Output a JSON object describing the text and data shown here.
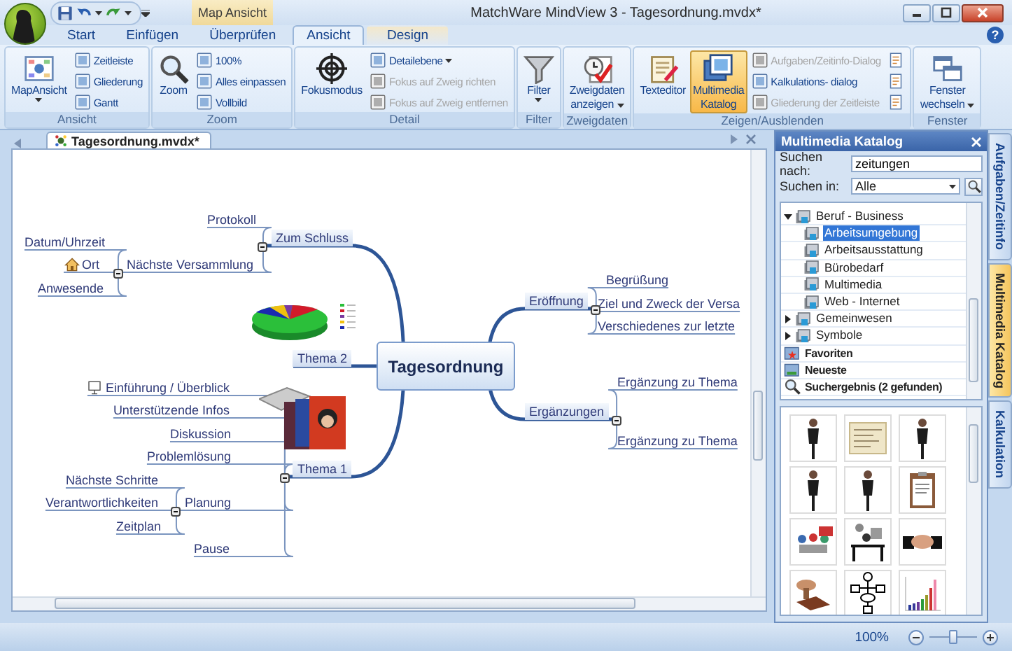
{
  "window": {
    "title": "MatchWare MindView 3 - Tagesordnung.mvdx*"
  },
  "contextual_tab": "Map Ansicht",
  "tabs": [
    {
      "label": "Start",
      "selected": false
    },
    {
      "label": "Einfügen",
      "selected": false
    },
    {
      "label": "Überprüfen",
      "selected": false
    },
    {
      "label": "Ansicht",
      "selected": true
    },
    {
      "label": "Design",
      "selected": false
    }
  ],
  "help_button": "?",
  "ribbon": [
    {
      "name": "Ansicht",
      "items": [
        {
          "label": [
            "MapAnsicht"
          ],
          "kind": "large",
          "dropdown": true,
          "disabled": false,
          "on": false
        },
        {
          "label": "Zeitleiste",
          "kind": "small",
          "dropdown": false,
          "disabled": false,
          "on": false
        },
        {
          "label": "Gliederung",
          "kind": "small",
          "dropdown": false,
          "disabled": false,
          "on": false
        },
        {
          "label": "Gantt",
          "kind": "small",
          "dropdown": false,
          "disabled": false,
          "on": false
        }
      ]
    },
    {
      "name": "Zoom",
      "items": [
        {
          "label": [
            "Zoom"
          ],
          "kind": "large",
          "dropdown": false,
          "disabled": false,
          "on": false
        },
        {
          "label": "100%",
          "kind": "small",
          "dropdown": false,
          "disabled": false,
          "on": false
        },
        {
          "label": "Alles einpassen",
          "kind": "small",
          "dropdown": false,
          "disabled": false,
          "on": false
        },
        {
          "label": "Vollbild",
          "kind": "small",
          "dropdown": false,
          "disabled": false,
          "on": false
        }
      ]
    },
    {
      "name": "Detail",
      "items": [
        {
          "label": [
            "Fokusmodus"
          ],
          "kind": "large",
          "dropdown": false,
          "disabled": false,
          "on": false
        },
        {
          "label": "Detailebene",
          "kind": "small",
          "dropdown": true,
          "disabled": false,
          "on": false
        },
        {
          "label": "Fokus auf Zweig richten",
          "kind": "small",
          "dropdown": false,
          "disabled": true,
          "on": false
        },
        {
          "label": "Fokus auf Zweig entfernen",
          "kind": "small",
          "dropdown": false,
          "disabled": true,
          "on": false
        }
      ]
    },
    {
      "name": "Filter",
      "items": [
        {
          "label": [
            "Filter"
          ],
          "kind": "large",
          "dropdown": true,
          "disabled": false,
          "on": false
        }
      ]
    },
    {
      "name": "Zweigdaten",
      "items": [
        {
          "label": [
            "Zweigdaten",
            "anzeigen"
          ],
          "kind": "large",
          "dropdown": true,
          "disabled": false,
          "on": false
        }
      ]
    },
    {
      "name": "Zeigen/Ausblenden",
      "items": [
        {
          "label": [
            "Texteditor"
          ],
          "kind": "large",
          "dropdown": false,
          "disabled": false,
          "on": false
        },
        {
          "label": [
            "Multimedia",
            "Katalog"
          ],
          "kind": "large",
          "dropdown": false,
          "disabled": false,
          "on": true
        },
        {
          "label": "Aufgaben/Zeitinfo-Dialog",
          "kind": "small",
          "dropdown": false,
          "disabled": true,
          "on": false
        },
        {
          "label": "Kalkulations- dialog",
          "kind": "small",
          "dropdown": false,
          "disabled": false,
          "on": false
        },
        {
          "label": "Gliederung der Zeitleiste",
          "kind": "small",
          "dropdown": false,
          "disabled": true,
          "on": false
        },
        {
          "kind": "icon",
          "dropdown": false,
          "disabled": false,
          "on": false
        },
        {
          "kind": "icon",
          "dropdown": false,
          "disabled": false,
          "on": false
        },
        {
          "kind": "icon",
          "dropdown": false,
          "disabled": false,
          "on": false
        }
      ]
    },
    {
      "name": "Fenster",
      "items": [
        {
          "label": [
            "Fenster",
            "wechseln"
          ],
          "kind": "large",
          "dropdown": true,
          "disabled": false,
          "on": false
        }
      ]
    }
  ],
  "document_tab": "Tagesordnung.mvdx*",
  "mind_map": {
    "central": "Tagesordnung",
    "branches": [
      {
        "label": "Zum Schluss",
        "kind": "topic",
        "expanded": true,
        "children": [
          {
            "label": "Protokoll",
            "kind": "topic"
          },
          {
            "label": "Nächste Versammlung",
            "kind": "topic",
            "expanded": true,
            "children": [
              {
                "label": "Datum/Uhrzeit",
                "kind": "topic"
              },
              {
                "label": "Ort",
                "kind": "location"
              },
              {
                "label": "Anwesende",
                "kind": "topic"
              }
            ]
          }
        ]
      },
      {
        "label": "Thema 2",
        "kind": "chart_picture"
      },
      {
        "label": "Thema 1",
        "kind": "photo_picture",
        "expanded": true,
        "children": [
          {
            "label": "Einführung / Überblick",
            "kind": "slide"
          },
          {
            "label": "Unterstützende Infos",
            "kind": "topic"
          },
          {
            "label": "Diskussion",
            "kind": "topic"
          },
          {
            "label": "Problemlösung",
            "kind": "topic"
          },
          {
            "label": "Planung",
            "kind": "topic",
            "expanded": true,
            "children": [
              {
                "label": "Nächste Schritte",
                "kind": "topic"
              },
              {
                "label": "Verantwortlichkeiten",
                "kind": "topic"
              },
              {
                "label": "Zeitplan",
                "kind": "topic"
              }
            ]
          },
          {
            "label": "Pause",
            "kind": "topic"
          }
        ]
      },
      {
        "label": "Eröffnung",
        "kind": "topic",
        "expanded": true,
        "children": [
          {
            "label": "Begrüßung",
            "kind": "topic"
          },
          {
            "label": "Ziel und Zweck der Versa",
            "kind": "topic"
          },
          {
            "label": "Verschiedenes zur letzte",
            "kind": "topic"
          }
        ]
      },
      {
        "label": "Ergänzungen",
        "kind": "topic",
        "expanded": true,
        "children": [
          {
            "label": "Ergänzung zu Thema",
            "kind": "topic"
          },
          {
            "label": "Ergänzung zu Thema",
            "kind": "topic"
          }
        ]
      }
    ]
  },
  "catalog": {
    "title": "Multimedia Katalog",
    "search_label": "Suchen nach:",
    "search_value": "zeitungen",
    "scope_label": "Suchen in:",
    "scope_value": "Alle",
    "tree": [
      {
        "label": "Beruf - Business",
        "kind": "folder",
        "selected": false,
        "expanded": true,
        "children": [
          {
            "label": "Arbeitsumgebung",
            "kind": "folder",
            "selected": true
          },
          {
            "label": "Arbeitsausstattung",
            "kind": "folder",
            "selected": false
          },
          {
            "label": "Bürobedarf",
            "kind": "folder",
            "selected": false
          },
          {
            "label": "Multimedia",
            "kind": "folder",
            "selected": false
          },
          {
            "label": "Web - Internet",
            "kind": "folder",
            "selected": false
          }
        ]
      },
      {
        "label": "Gemeinwesen",
        "kind": "folder",
        "selected": false,
        "expanded": false
      },
      {
        "label": "Symbole",
        "kind": "folder",
        "selected": false,
        "expanded": false
      },
      {
        "label": "Favoriten",
        "kind": "favorites",
        "selected": false
      },
      {
        "label": "Neueste",
        "kind": "recent",
        "selected": false
      },
      {
        "label": "Suchergebnis (2 gefunden)",
        "kind": "results",
        "selected": false
      }
    ],
    "thumbnails": [
      {
        "kind": "person"
      },
      {
        "kind": "document"
      },
      {
        "kind": "person"
      },
      {
        "kind": "person"
      },
      {
        "kind": "person"
      },
      {
        "kind": "clipboard"
      },
      {
        "kind": "meeting"
      },
      {
        "kind": "desk"
      },
      {
        "kind": "handshake"
      },
      {
        "kind": "stamp"
      },
      {
        "kind": "flowchart"
      },
      {
        "kind": "chart"
      }
    ]
  },
  "side_tabs": [
    {
      "label": "Aufgaben/Zeitinfo",
      "selected": false
    },
    {
      "label": "Multimedia Katalog",
      "selected": true
    },
    {
      "label": "Kalkulation",
      "selected": false
    }
  ],
  "status_bar": {
    "zoom": "100%",
    "zoom_slider": {
      "level": 0.5
    }
  }
}
